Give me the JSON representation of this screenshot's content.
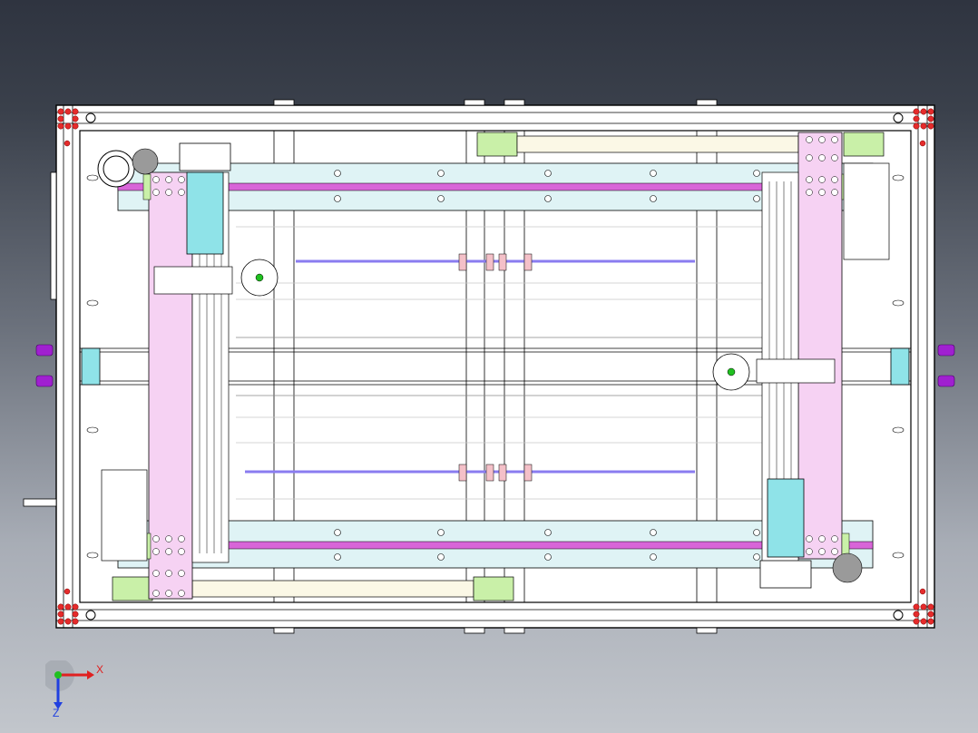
{
  "viewport": {
    "background_top": "#2f3440",
    "background_bottom": "#c2c6cc"
  },
  "model": {
    "frame_color": "#000000",
    "rail_fill": "#dff3f5",
    "carriage_fill": "#f6d2f3",
    "slot_color": "#c04fd0",
    "motor_color": "#8fe3e8",
    "accent_green": "#c9f0a8",
    "bolt_red": "#e52b2b",
    "purple_knob": "#a020d0"
  },
  "triad": {
    "x_label": "X",
    "z_label": "Z",
    "x_color": "#e02020",
    "z_color": "#2040e0",
    "origin_color": "#20c020"
  }
}
